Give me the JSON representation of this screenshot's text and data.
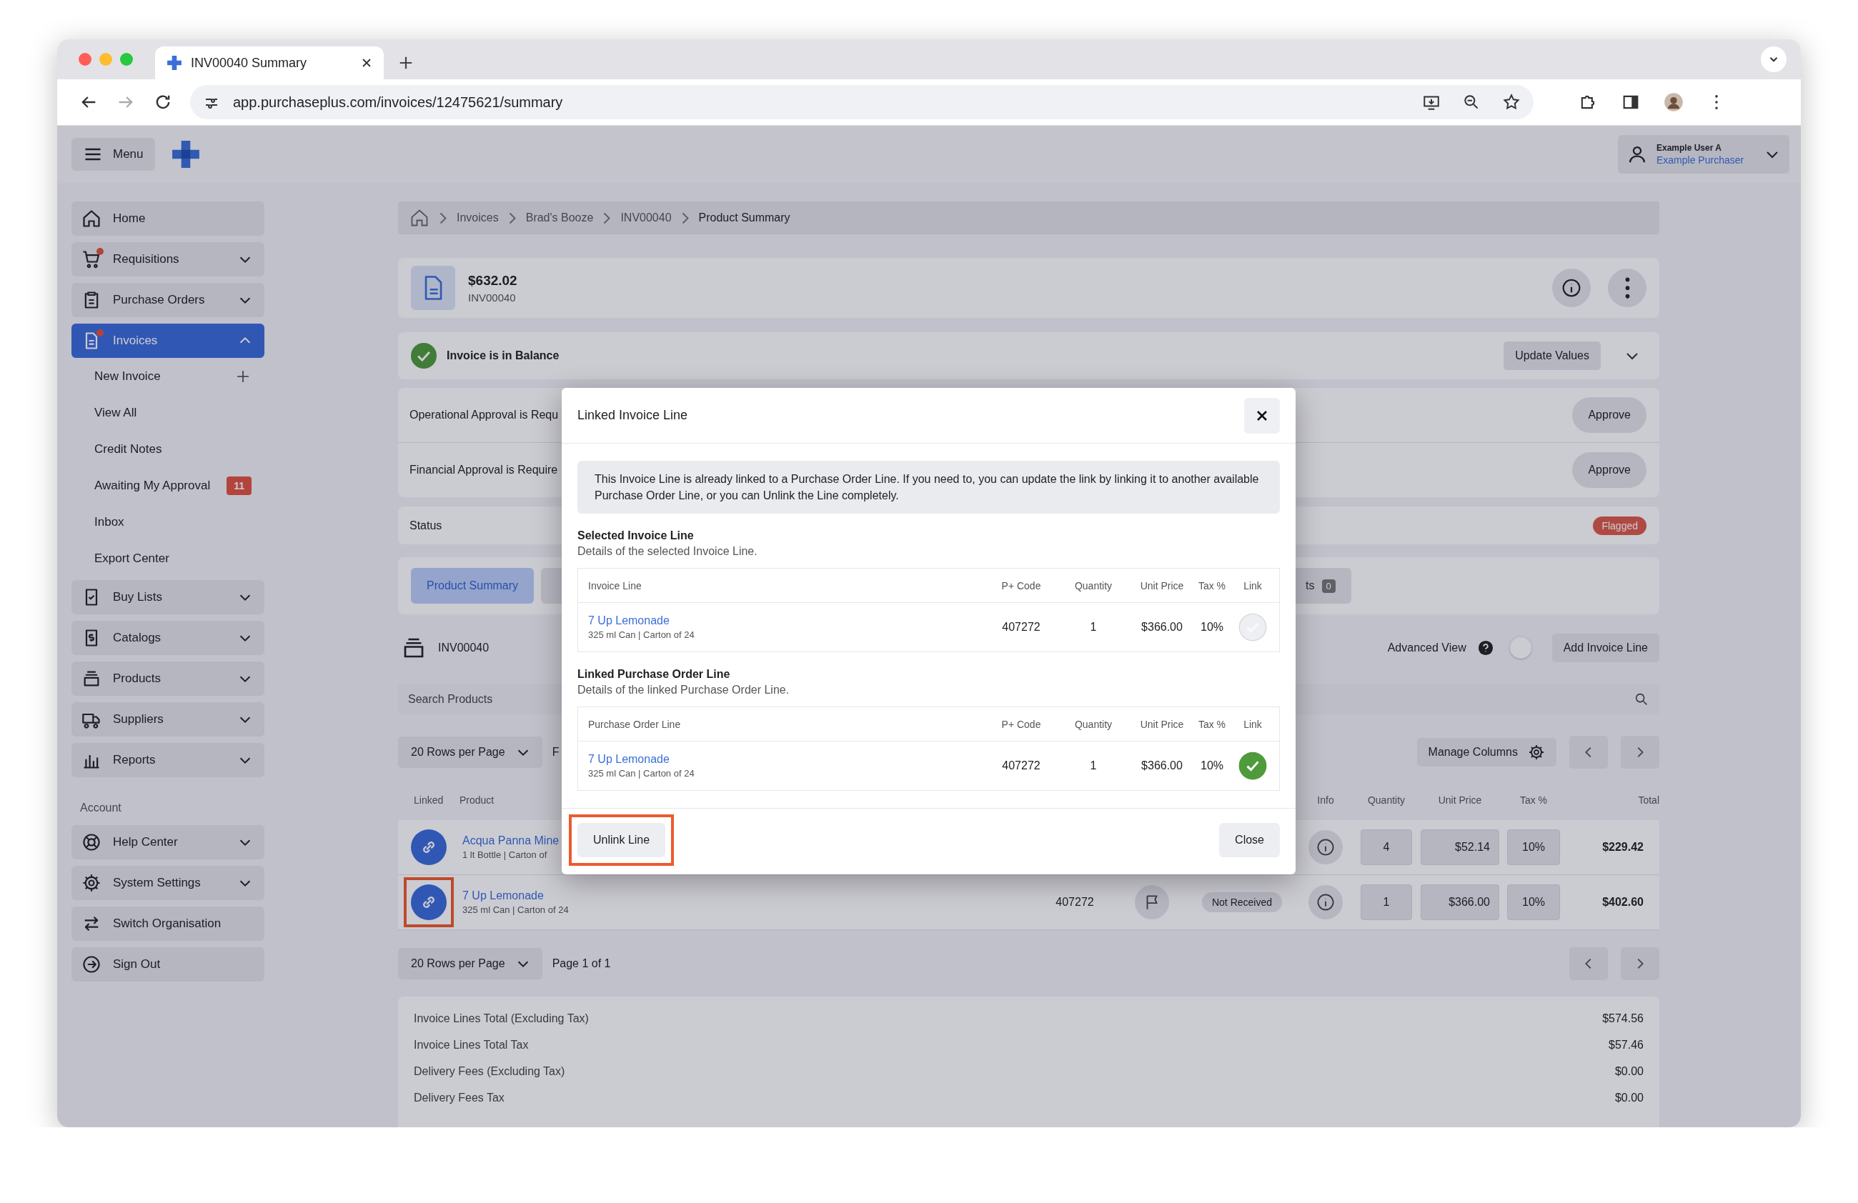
{
  "browser": {
    "tab_title": "INV00040 Summary",
    "url": "app.purchaseplus.com/invoices/12475621/summary"
  },
  "header": {
    "menu_label": "Menu",
    "user_name": "Example User A",
    "user_role": "Example Purchaser"
  },
  "sidebar": {
    "nav": [
      {
        "label": "Home",
        "kind": "link",
        "selected": false,
        "alert": false
      },
      {
        "label": "Requisitions",
        "kind": "group",
        "selected": false,
        "alert": true,
        "expanded": false
      },
      {
        "label": "Purchase Orders",
        "kind": "group",
        "selected": false,
        "alert": false,
        "expanded": false
      },
      {
        "label": "Invoices",
        "kind": "group",
        "selected": true,
        "alert": true,
        "expanded": true,
        "children": [
          {
            "label": "New Invoice",
            "kind": "add"
          },
          {
            "label": "View All",
            "kind": "plain"
          },
          {
            "label": "Credit Notes",
            "kind": "plain"
          },
          {
            "label": "Awaiting My Approval",
            "kind": "count",
            "badge": "11"
          },
          {
            "label": "Inbox",
            "kind": "plain"
          },
          {
            "label": "Export Center",
            "kind": "plain"
          }
        ]
      },
      {
        "label": "Buy Lists",
        "kind": "group",
        "selected": false,
        "alert": false,
        "expanded": false
      },
      {
        "label": "Catalogs",
        "kind": "group",
        "selected": false,
        "alert": false,
        "expanded": false
      },
      {
        "label": "Products",
        "kind": "group",
        "selected": false,
        "alert": false,
        "expanded": false
      },
      {
        "label": "Suppliers",
        "kind": "group",
        "selected": false,
        "alert": false,
        "expanded": false
      },
      {
        "label": "Reports",
        "kind": "group",
        "selected": false,
        "alert": false,
        "expanded": false
      }
    ],
    "account_heading": "Account",
    "account": [
      {
        "label": "Help Center",
        "kind": "group",
        "selected": false,
        "alert": false,
        "expanded": false
      },
      {
        "label": "System Settings",
        "kind": "group",
        "selected": false,
        "alert": false,
        "expanded": false
      },
      {
        "label": "Switch Organisation",
        "kind": "link",
        "selected": false,
        "alert": false
      },
      {
        "label": "Sign Out",
        "kind": "link",
        "selected": false,
        "alert": false
      }
    ]
  },
  "breadcrumb": [
    "Invoices",
    "Brad's Booze",
    "INV00040",
    "Product Summary"
  ],
  "invoice": {
    "amount": "$632.02",
    "number": "INV00040"
  },
  "balance": {
    "message": "Invoice is in Balance",
    "button": "Update Values"
  },
  "approvals": [
    {
      "text": "Operational Approval is Requ",
      "button": "Approve"
    },
    {
      "text": "Financial Approval is Require",
      "button": "Approve"
    }
  ],
  "status": {
    "label": "Status",
    "value": "Flagged"
  },
  "tabs": [
    {
      "label": "Product Summary",
      "selected": true
    },
    {
      "selected": false
    },
    {
      "label": "ts",
      "count": "0",
      "selected": false
    }
  ],
  "lines_header": {
    "title": "INV00040",
    "advanced_view_label": "Advanced View",
    "advanced_view_on": false,
    "add_button": "Add Invoice Line"
  },
  "search": {
    "placeholder": "Search Products"
  },
  "pager_top": {
    "rows_label": "20 Rows per Page",
    "page_text": "F",
    "manage_columns": "Manage Columns"
  },
  "table": {
    "columns": [
      "Linked",
      "Product",
      "Info",
      "Quantity",
      "Unit Price",
      "Tax %",
      "Total"
    ],
    "rows": [
      {
        "linked": true,
        "highlighted": false,
        "name": "Acqua Panna Mine",
        "detail": "1 lt Bottle | Carton of",
        "quantity": "4",
        "unit_price": "$52.14",
        "tax": "10%",
        "total": "$229.42"
      },
      {
        "linked": true,
        "highlighted": true,
        "name": "7 Up Lemonade",
        "detail": "325 ml Can | Carton of 24",
        "p_code": "407272",
        "status": "Not Received",
        "quantity": "1",
        "unit_price": "$366.00",
        "tax": "10%",
        "total": "$402.60"
      }
    ]
  },
  "pager_bottom": {
    "rows_label": "20 Rows per Page",
    "page_text": "Page 1 of 1"
  },
  "totals": [
    {
      "label": "Invoice Lines Total (Excluding Tax)",
      "value": "$574.56"
    },
    {
      "label": "Invoice Lines Total Tax",
      "value": "$57.46"
    },
    {
      "label": "Delivery Fees (Excluding Tax)",
      "value": "$0.00"
    },
    {
      "label": "Delivery Fees Tax",
      "value": "$0.00"
    }
  ],
  "modal": {
    "title": "Linked Invoice Line",
    "notice": "This Invoice Line is already linked to a Purchase Order Line. If you need to, you can update the link by linking it to another available Purchase Order Line, or you can Unlink the Line completely.",
    "sections": [
      {
        "title": "Selected Invoice Line",
        "subtitle": "Details of the selected Invoice Line.",
        "columns": [
          "Invoice Line",
          "P+ Code",
          "Quantity",
          "Unit Price",
          "Tax %",
          "Link"
        ],
        "row": {
          "name": "7 Up Lemonade",
          "detail": "325 ml Can | Carton of 24",
          "p_code": "407272",
          "quantity": "1",
          "unit_price": "$366.00",
          "tax": "10%",
          "linked": false
        }
      },
      {
        "title": "Linked Purchase Order Line",
        "subtitle": "Details of the linked Purchase Order Line.",
        "columns": [
          "Purchase Order Line",
          "P+ Code",
          "Quantity",
          "Unit Price",
          "Tax %",
          "Link"
        ],
        "row": {
          "name": "7 Up Lemonade",
          "detail": "325 ml Can | Carton of 24",
          "p_code": "407272",
          "quantity": "1",
          "unit_price": "$366.00",
          "tax": "10%",
          "linked": true
        }
      }
    ],
    "unlink_button": {
      "label": "Unlink Line",
      "highlighted": true
    },
    "close_button": "Close"
  }
}
